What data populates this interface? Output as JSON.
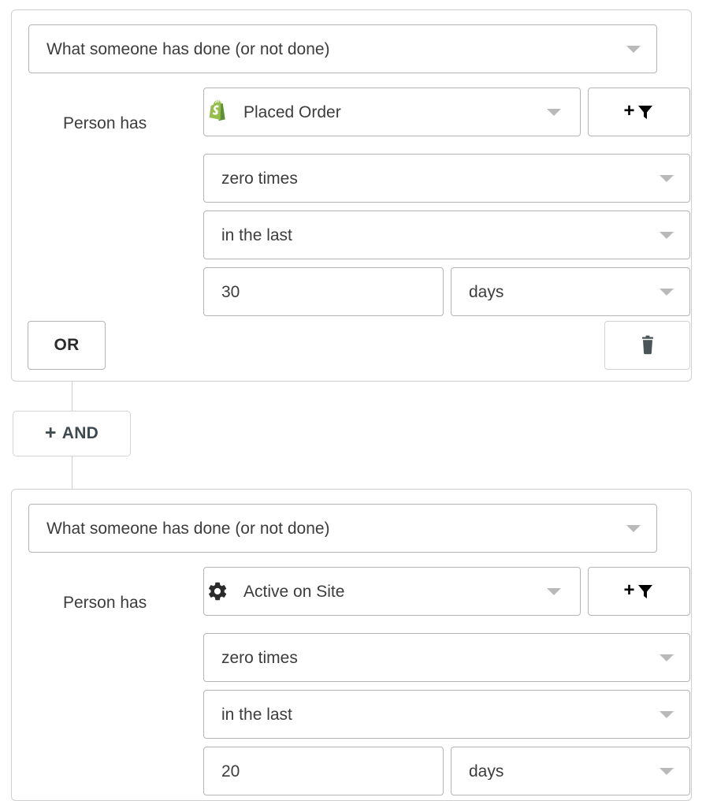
{
  "conditions": [
    {
      "type_select": {
        "value": "What someone has done (or not done)",
        "caret": "chevron-down-icon"
      },
      "row_label": "Person has",
      "event_select": {
        "value": "Placed Order",
        "icon": "shopify-icon",
        "caret": "chevron-down-icon"
      },
      "filter_button": {
        "plus": "+",
        "icon": "funnel-filter-icon"
      },
      "frequency_select": {
        "value": "zero times",
        "caret": "chevron-down-icon"
      },
      "timeframe_select": {
        "value": "in the last",
        "caret": "chevron-down-icon"
      },
      "amount_input": {
        "value": "30",
        "placeholder": ""
      },
      "unit_select": {
        "value": "days",
        "caret": "chevron-down-icon"
      },
      "or_button": "OR",
      "delete_button": {
        "icon": "trash-icon"
      }
    },
    {
      "type_select": {
        "value": "What someone has done (or not done)",
        "caret": "chevron-down-icon"
      },
      "row_label": "Person has",
      "event_select": {
        "value": "Active on Site",
        "icon": "gear-icon",
        "caret": "chevron-down-icon"
      },
      "filter_button": {
        "plus": "+",
        "icon": "funnel-filter-icon"
      },
      "frequency_select": {
        "value": "zero times",
        "caret": "chevron-down-icon"
      },
      "timeframe_select": {
        "value": "in the last",
        "caret": "chevron-down-icon"
      },
      "amount_input": {
        "value": "20",
        "placeholder": ""
      },
      "unit_select": {
        "value": "days",
        "caret": "chevron-down-icon"
      }
    }
  ],
  "and_button": {
    "plus": "+",
    "label": "AND"
  },
  "colors": {
    "card_border": "#cfcfcf",
    "control_border": "#b4b4b4",
    "text": "#3c3c3c",
    "caret": "#b9b9b9",
    "shopify_green": "#95BF47",
    "trash": "#4a5557",
    "and_text": "#3f4a50"
  }
}
